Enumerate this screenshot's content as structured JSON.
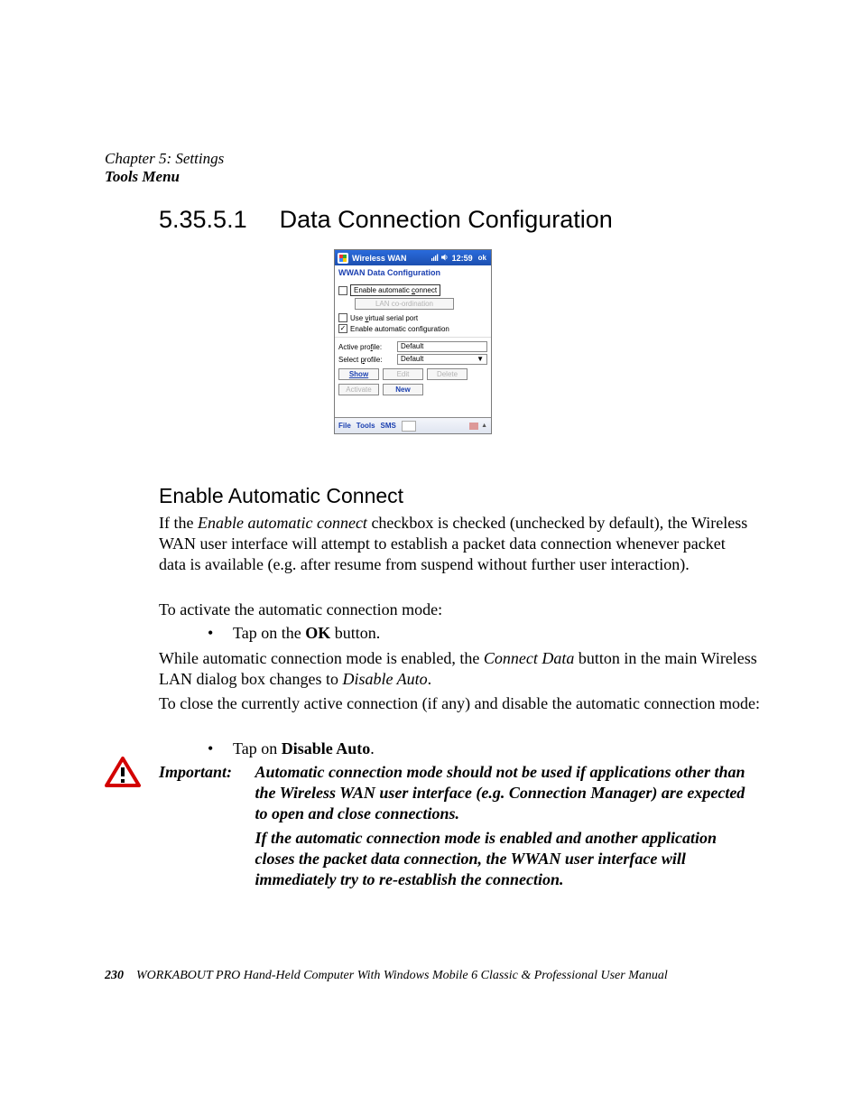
{
  "header": {
    "chapter": "Chapter 5: Settings",
    "section": "Tools Menu"
  },
  "title": {
    "number": "5.35.5.1",
    "text": "Data Connection Configuration"
  },
  "device": {
    "titlebar": {
      "title": "Wireless WAN",
      "time": "12:59",
      "ok": "ok"
    },
    "subheader": "WWAN Data Configuration",
    "checks": {
      "auto_connect_prefix": "Enable automatic ",
      "auto_connect_key": "c",
      "auto_connect_suffix": "onnect",
      "lan_coord": "LAN co-ordination",
      "virtual_prefix": "Use ",
      "virtual_key": "v",
      "virtual_suffix": "irtual serial port",
      "auto_config": "Enable automatic configuration"
    },
    "profile": {
      "active_prefix": "Active pro",
      "active_key": "f",
      "active_suffix": "ile:",
      "active_value": "Default",
      "select_prefix": "Select ",
      "select_key": "p",
      "select_suffix": "rofile:",
      "select_value": "Default"
    },
    "buttons": {
      "show": "Show",
      "edit": "Edit",
      "delete": "Delete",
      "activate": "Activate",
      "new": "New"
    },
    "menubar": {
      "file": "File",
      "tools": "Tools",
      "sms": "SMS"
    }
  },
  "subheading": "Enable Automatic Connect",
  "paras": {
    "p1a": "If the ",
    "p1b": "Enable automatic connect",
    "p1c": " checkbox is checked (unchecked by default), the Wireless WAN user interface will attempt to establish a packet data connection whenever packet data is available (e.g. after resume from suspend without further user interaction).",
    "p2": "To activate the automatic connection mode:",
    "b1a": "Tap on the ",
    "b1b": "OK",
    "b1c": " button.",
    "p4a": "While automatic connection mode is enabled, the ",
    "p4b": "Connect Data",
    "p4c": " button in the main Wireless LAN dialog box changes to ",
    "p4d": "Disable Auto",
    "p4e": ".",
    "p5": "To close the currently active connection (if any) and disable the automatic connection mode:",
    "b2a": "Tap on ",
    "b2b": "Disable Auto",
    "b2c": "."
  },
  "important": {
    "label": "Important:",
    "t1": "Automatic connection mode should not be used if applications other than the Wireless WAN user interface (e.g. Connection Manager) are expected to open and close connections.",
    "t2": "If the automatic connection mode is enabled and another application closes the packet data connection, the WWAN user interface will immediately try to re-establish the connection."
  },
  "footer": {
    "page": "230",
    "text": "WORKABOUT PRO Hand-Held Computer With Windows Mobile 6 Classic & Professional User Manual"
  }
}
